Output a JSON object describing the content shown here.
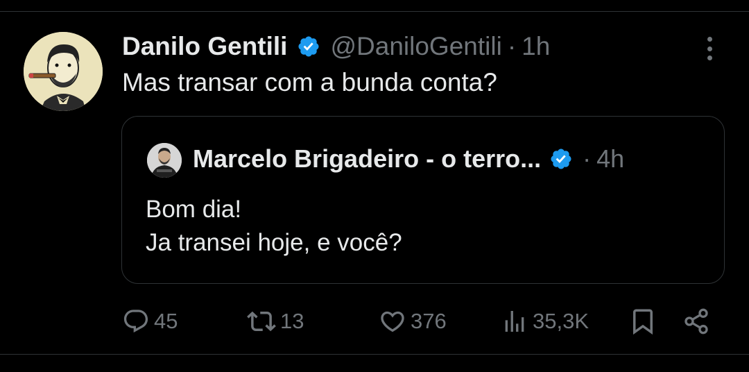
{
  "tweet": {
    "author_name": "Danilo Gentili",
    "handle": "@DaniloGentili",
    "separator": "·",
    "time": "1h",
    "text": "Mas transar com a bunda conta?"
  },
  "quote": {
    "author_name": "Marcelo Brigadeiro - o terro...",
    "separator": "·",
    "time": "4h",
    "text_line1": "Bom dia!",
    "text_line2": "Ja transei hoje, e você?"
  },
  "actions": {
    "replies": "45",
    "reposts": "13",
    "likes": "376",
    "views": "35,3K"
  },
  "colors": {
    "background": "#000000",
    "text": "#e7e9ea",
    "muted": "#71767b",
    "verified": "#1d9bf0",
    "border": "#2f3336"
  },
  "icons": [
    "more-icon",
    "verified-icon",
    "reply-icon",
    "repost-icon",
    "like-icon",
    "views-icon",
    "bookmark-icon",
    "share-icon"
  ]
}
